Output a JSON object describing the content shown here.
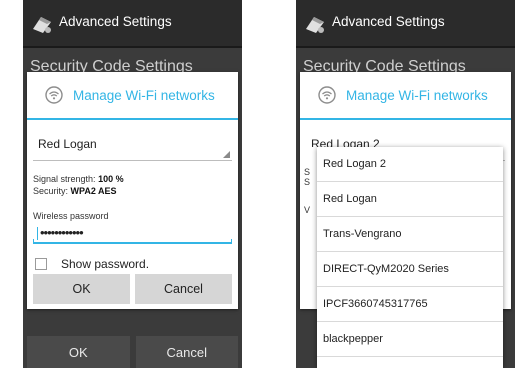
{
  "colors": {
    "accent": "#33b5e5",
    "screen_bg": "#3b3b3b",
    "actionbar_bg": "#2b2b2b"
  },
  "left": {
    "actionbar_title": "Advanced Settings",
    "bg_heading": "Security Code Settings",
    "bg_buttons": {
      "ok": "OK",
      "cancel": "Cancel"
    },
    "dialog": {
      "title": "Manage Wi-Fi networks",
      "network": "Red Logan",
      "signal_label": "Signal strength:",
      "signal_value": "100 %",
      "security_label": "Security:",
      "security_value": "WPA2 AES",
      "password_label": "Wireless password",
      "password_value": "••••••••••••",
      "show_password": "Show password.",
      "ok": "OK",
      "cancel": "Cancel"
    }
  },
  "right": {
    "actionbar_title": "Advanced Settings",
    "bg_heading": "Security Code Settings",
    "dialog": {
      "title": "Manage Wi-Fi networks",
      "network": "Red Logan 2"
    },
    "dropdown_options": [
      "Red Logan 2",
      "Red Logan",
      "Trans-Vengrano",
      "DIRECT-QyM2020 Series",
      "IPCF3660745317765",
      "blackpepper"
    ]
  }
}
